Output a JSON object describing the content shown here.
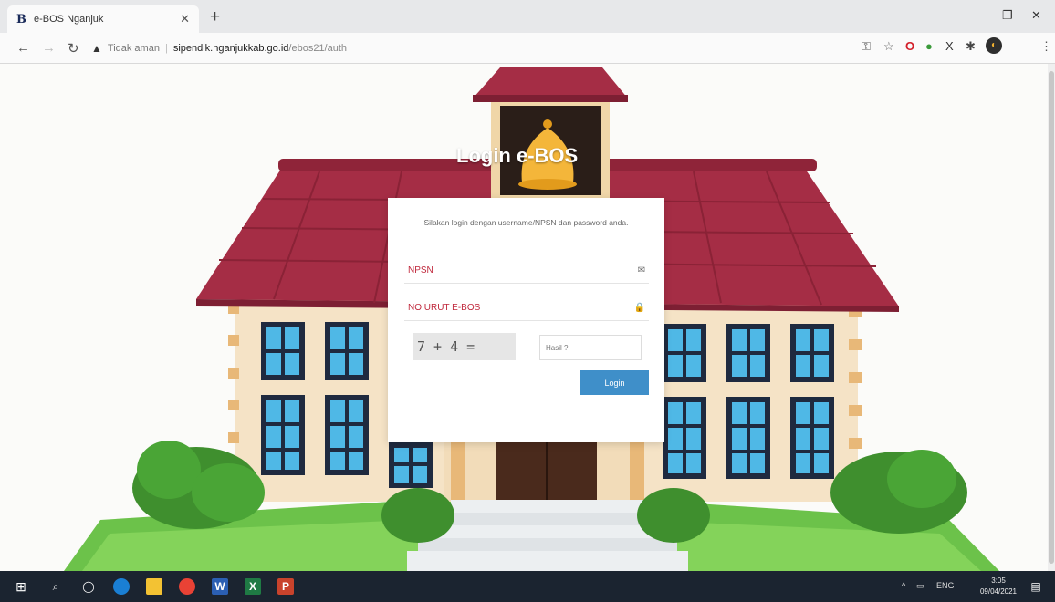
{
  "browser": {
    "tab_title": "e-BOS Nganjuk",
    "favicon_text": "B",
    "security_label": "Tidak aman",
    "url_host": "sipendik.nganjukkab.go.id",
    "url_path": "/ebos21/auth"
  },
  "page": {
    "heading": "Login e-BOS",
    "intro": "Silakan login dengan username/NPSN dan password anda.",
    "npsn_placeholder": "NPSN",
    "no_urut_placeholder": "NO URUT E-BOS",
    "captcha_question": "7 + 4 =",
    "captcha_placeholder": "Hasil ?",
    "login_button": "Login"
  },
  "taskbar": {
    "language": "ENG",
    "time": "3:05",
    "date": "09/04/2021"
  },
  "colors": {
    "roof": "#a52d45",
    "wall": "#f5e3c6",
    "window_frame": "#1f2a3f",
    "window_glass": "#4fb8e6",
    "login_button": "#3f8fc9",
    "field_label": "#c0283c"
  }
}
